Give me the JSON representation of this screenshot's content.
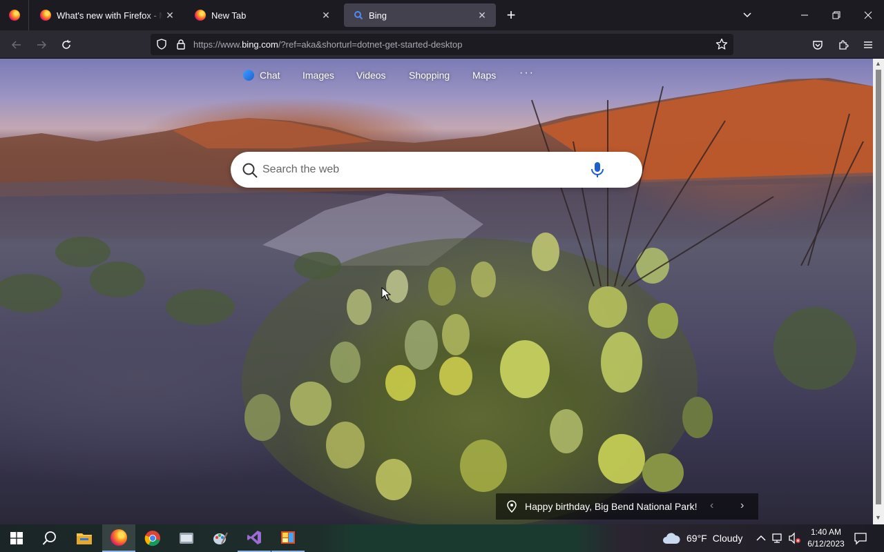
{
  "browser": {
    "tabs": [
      {
        "title": "What's new with Firefox - More",
        "icon": "firefox-icon"
      },
      {
        "title": "New Tab",
        "icon": "firefox-icon"
      },
      {
        "title": "Bing",
        "icon": "bing-icon",
        "active": true
      }
    ],
    "url_prefix": "https://www.",
    "url_host": "bing.com",
    "url_rest": "/?ref=aka&shorturl=dotnet-get-started-desktop"
  },
  "bing": {
    "nav": {
      "chat": "Chat",
      "images": "Images",
      "videos": "Videos",
      "shopping": "Shopping",
      "maps": "Maps",
      "more": "···"
    },
    "search_placeholder": "Search the web",
    "caption": "Happy birthday, Big Bend National Park!",
    "caption_prev": "‹",
    "caption_next": "›"
  },
  "taskbar": {
    "apps": [
      "start-icon",
      "search-icon",
      "file-explorer-icon",
      "firefox-icon",
      "chrome-icon",
      "app-icon",
      "paint-icon",
      "visual-studio-icon",
      "app-icon"
    ],
    "weather": {
      "temp": "69°F",
      "condition": "Cloudy"
    },
    "time": "1:40 AM",
    "date": "6/12/2023"
  },
  "colors": {
    "tab_strip": "#1c1b22",
    "nav_bar": "#2b2a33",
    "active_tab": "#42414d",
    "accent": "#8fb7e8"
  }
}
